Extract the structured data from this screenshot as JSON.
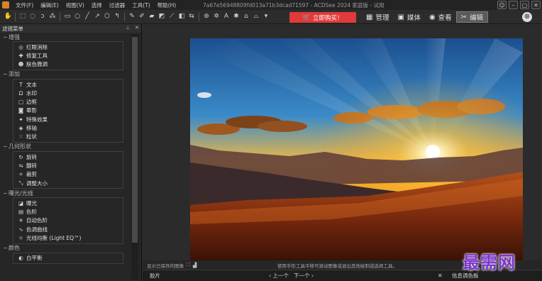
{
  "window": {
    "title": "7a67e56948809fd013a71b3dcad71597 - ACDSee 2024 家庭版 - 试用",
    "menu": [
      "文件(F)",
      "编辑(E)",
      "视图(V)",
      "选择",
      "过滤器",
      "工具(T)",
      "帮助(H)"
    ],
    "controls": [
      "–",
      "▢",
      "✕"
    ]
  },
  "toolbar": {
    "buy_label": "立即购买！",
    "modes": [
      {
        "icon": "grid-icon",
        "label": "管理",
        "active": false
      },
      {
        "icon": "media-icon",
        "label": "媒体",
        "active": false
      },
      {
        "icon": "eye-icon",
        "label": "查看",
        "active": false
      },
      {
        "icon": "edit-icon",
        "label": "编辑",
        "active": true
      }
    ]
  },
  "panel": {
    "title": "滤镜菜单",
    "groups": [
      {
        "name": "增强",
        "items": [
          {
            "icon": "red-eye-icon",
            "label": "红眼消除"
          },
          {
            "icon": "repair-icon",
            "label": "修复工具"
          },
          {
            "icon": "skin-icon",
            "label": "肤色微调"
          }
        ]
      },
      {
        "name": "添加",
        "items": [
          {
            "icon": "text-icon",
            "label": "文本"
          },
          {
            "icon": "watermark-icon",
            "label": "水印"
          },
          {
            "icon": "border-icon",
            "label": "边框"
          },
          {
            "icon": "vignette-icon",
            "label": "晕影"
          },
          {
            "icon": "effects-icon",
            "label": "特殊效果"
          },
          {
            "icon": "tilt-shift-icon",
            "label": "移轴"
          },
          {
            "icon": "grain-icon",
            "label": "粒状"
          }
        ]
      },
      {
        "name": "几何形状",
        "items": [
          {
            "icon": "rotate-icon",
            "label": "旋转"
          },
          {
            "icon": "flip-icon",
            "label": "翻转"
          },
          {
            "icon": "crop-icon",
            "label": "裁剪"
          },
          {
            "icon": "resize-icon",
            "label": "调整大小"
          }
        ]
      },
      {
        "name": "曝光/光线",
        "items": [
          {
            "icon": "exposure-icon",
            "label": "曝光"
          },
          {
            "icon": "levels-icon",
            "label": "色阶"
          },
          {
            "icon": "auto-levels-icon",
            "label": "自动色阶"
          },
          {
            "icon": "curves-icon",
            "label": "色调曲线"
          },
          {
            "icon": "light-eq-icon",
            "label": "光线均衡 (Light EQ™)"
          }
        ]
      },
      {
        "name": "颜色",
        "items": [
          {
            "icon": "white-balance-icon",
            "label": "白平衡"
          }
        ]
      }
    ]
  },
  "status": {
    "left": "显示已保存的图像",
    "message": "使用手形工具平移可滚动图像或退出其他绘制或选择工具。"
  },
  "bottom": {
    "filmstrip": "胶片",
    "prev": "上一个",
    "next": "下一个",
    "info": "信息调色板"
  },
  "watermark": "最需网",
  "colors": {
    "buy": "#e03a3a",
    "accent_watermark": "#7b36c8"
  }
}
